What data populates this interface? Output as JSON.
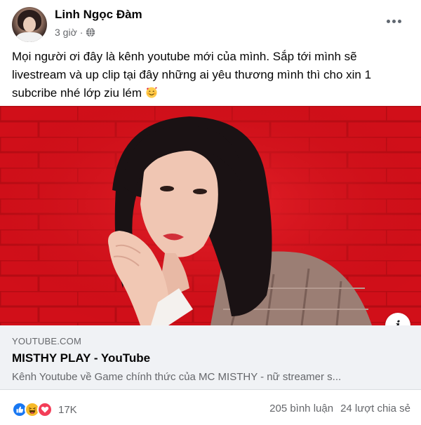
{
  "post": {
    "author": "Linh Ngọc Đàm",
    "time": "3 giờ",
    "separator": "·",
    "text": "Mọi người ơi đây là kênh youtube mới của mình. Sắp tới mình sẽ livestream và up clip tại đây những ai yêu thương mình thì cho xin 1 subcribe nhé lớp ziu lém",
    "privacy_icon": "globe-icon",
    "more_icon": "more-options-icon"
  },
  "link_preview": {
    "domain": "YOUTUBE.COM",
    "title": "MISTHY PLAY - YouTube",
    "description": "Kênh Youtube về Game chính thức của MC MISTHY - nữ streamer s..."
  },
  "footer": {
    "reaction_icons": [
      "like-icon",
      "haha-icon",
      "love-icon"
    ],
    "reaction_count": "17K",
    "comments": "205 bình luận",
    "shares": "24 lượt chia sẻ"
  },
  "colors": {
    "facebook_blue": "#1877f2",
    "photo_background": "#d4121b",
    "secondary_text": "#65676b"
  }
}
